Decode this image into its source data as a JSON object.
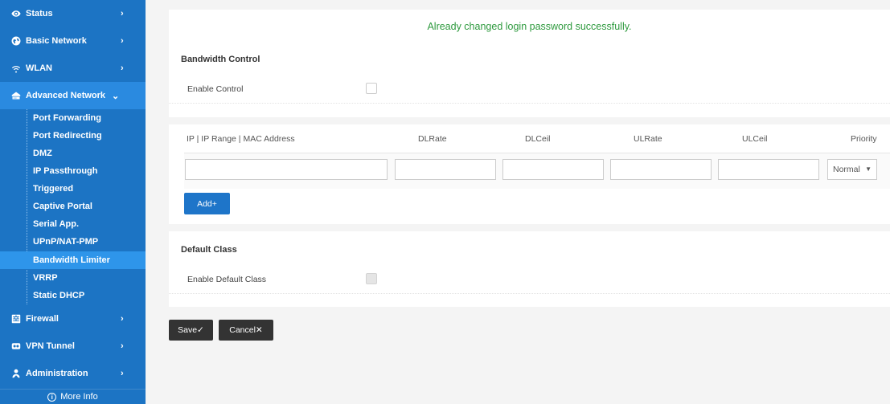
{
  "sidebar": {
    "menu": [
      {
        "label": "Status",
        "icon": "eye-icon",
        "chevron": "›"
      },
      {
        "label": "Basic Network",
        "icon": "globe-icon",
        "chevron": "›"
      },
      {
        "label": "WLAN",
        "icon": "wifi-icon",
        "chevron": "›"
      },
      {
        "label": "Advanced Network",
        "icon": "router-icon",
        "chevron": "⌄"
      },
      {
        "label": "Firewall",
        "icon": "firewall-icon",
        "chevron": "›"
      },
      {
        "label": "VPN Tunnel",
        "icon": "vpn-icon",
        "chevron": "›"
      },
      {
        "label": "Administration",
        "icon": "admin-icon",
        "chevron": "›"
      }
    ],
    "submenu": [
      {
        "label": "Port Forwarding"
      },
      {
        "label": "Port Redirecting"
      },
      {
        "label": "DMZ"
      },
      {
        "label": "IP Passthrough"
      },
      {
        "label": "Triggered"
      },
      {
        "label": "Captive Portal"
      },
      {
        "label": "Serial App."
      },
      {
        "label": "UPnP/NAT-PMP"
      },
      {
        "label": "Bandwidth Limiter"
      },
      {
        "label": "VRRP"
      },
      {
        "label": "Static DHCP"
      }
    ],
    "active_submenu": "Bandwidth Limiter",
    "more_info": "More Info",
    "more_info_icon": "i"
  },
  "banner": {
    "message": "Already changed login password successfully.",
    "color": "#2e9a3e"
  },
  "bandwidth_control": {
    "title": "Bandwidth Control",
    "enable_label": "Enable Control",
    "enabled": false
  },
  "rules_table": {
    "columns": [
      "IP | IP Range | MAC Address",
      "DLRate",
      "DLCeil",
      "ULRate",
      "ULCeil",
      "Priority"
    ],
    "new_row": {
      "ip": "",
      "dlrate": "",
      "dlceil": "",
      "ulrate": "",
      "ulceil": "",
      "priority": "Normal"
    },
    "priority_arrow": "▼",
    "add_button": "Add+"
  },
  "default_class": {
    "title": "Default Class",
    "enable_label": "Enable Default Class",
    "enabled": false
  },
  "actions": {
    "save": "Save✓",
    "cancel": "Cancel✕"
  },
  "colors": {
    "sidebar": "#1c74c4",
    "sidebar_active": "#2e95ea",
    "primary_button": "#1e75c9",
    "dark_button": "#333333"
  }
}
